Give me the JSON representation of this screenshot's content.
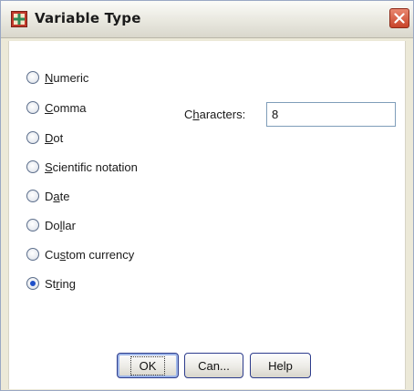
{
  "dialog": {
    "title": "Variable Type",
    "close_icon": "close-x-icon",
    "app_icon": "spss-variable-icon"
  },
  "options": [
    {
      "pre": "",
      "key": "N",
      "post": "umeric",
      "selected": false
    },
    {
      "pre": "",
      "key": "C",
      "post": "omma",
      "selected": false
    },
    {
      "pre": "",
      "key": "D",
      "post": "ot",
      "selected": false
    },
    {
      "pre": "",
      "key": "S",
      "post": "cientific notation",
      "selected": false
    },
    {
      "pre": "D",
      "key": "a",
      "post": "te",
      "selected": false
    },
    {
      "pre": "Do",
      "key": "l",
      "post": "lar",
      "selected": false
    },
    {
      "pre": "Cu",
      "key": "s",
      "post": "tom currency",
      "selected": false
    },
    {
      "pre": "St",
      "key": "r",
      "post": "ing",
      "selected": true
    }
  ],
  "characters": {
    "label_pre": "C",
    "label_key": "h",
    "label_post": "aracters:",
    "value": "8"
  },
  "buttons": {
    "ok": "OK",
    "cancel": "Can...",
    "help": "Help"
  },
  "colors": {
    "accent": "#1e4fc9",
    "close": "#c8442a"
  }
}
